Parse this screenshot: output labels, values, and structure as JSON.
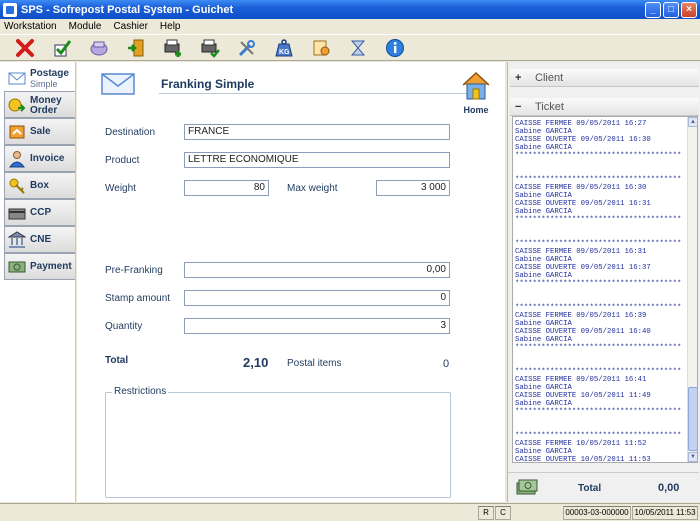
{
  "window": {
    "title": "SPS - Sofrepost Postal System - Guichet"
  },
  "menu": [
    {
      "label": "Workstation"
    },
    {
      "label": "Module"
    },
    {
      "label": "Cashier"
    },
    {
      "label": "Help"
    }
  ],
  "toolbar": {
    "icons": [
      "close-x-icon",
      "check-icon",
      "cart-icon",
      "exit-door-icon",
      "printer-add-icon",
      "printer-check-icon",
      "tools-icon",
      "weight-kg-icon",
      "money-exchange-icon",
      "hourglass-icon",
      "info-icon"
    ]
  },
  "nav": {
    "items": [
      {
        "label": "Postage",
        "sub": "Simple",
        "icon": "envelope-icon"
      },
      {
        "label": "Money",
        "sub": "Order",
        "icon": "money-order-icon"
      },
      {
        "label": "Sale",
        "sub": "",
        "icon": "sale-icon"
      },
      {
        "label": "Invoice",
        "sub": "",
        "icon": "person-icon"
      },
      {
        "label": "Box",
        "sub": "",
        "icon": "key-icon"
      },
      {
        "label": "CCP",
        "sub": "",
        "icon": "card-icon"
      },
      {
        "label": "CNE",
        "sub": "",
        "icon": "bank-icon"
      },
      {
        "label": "Payment",
        "sub": "",
        "icon": "banknote-icon"
      }
    ]
  },
  "form": {
    "title": "Franking Simple",
    "home_label": "Home",
    "destination_label": "Destination",
    "destination_value": "FRANCE",
    "product_label": "Product",
    "product_value": "LETTRE ECONOMIQUE",
    "weight_label": "Weight",
    "weight_value": "80",
    "max_weight_label": "Max weight",
    "max_weight_value": "3 000",
    "prefranking_label": "Pre-Franking",
    "prefranking_value": "0,00",
    "stamp_amount_label": "Stamp amount",
    "stamp_amount_value": "0",
    "quantity_label": "Quantity",
    "quantity_value": "3",
    "total_label": "Total",
    "total_value": "2,10",
    "postal_items_label": "Postal items",
    "postal_items_value": "0",
    "restrictions_label": "Restrictions"
  },
  "right_panel": {
    "client_toggle": "+",
    "client_label": "Client",
    "ticket_toggle": "−",
    "ticket_label": "Ticket",
    "ticket_text": "CAISSE FERMEE 09/05/2011 16:27\nSabine GARCIA\nCAISSE OUVERTE 09/05/2011 16:30\nSabine GARCIA\n**************************************\n\n\n**************************************\nCAISSE FERMEE 09/05/2011 16:30\nSabine GARCIA\nCAISSE OUVERTE 09/05/2011 16:31\nSabine GARCIA\n**************************************\n\n\n**************************************\nCAISSE FERMEE 09/05/2011 16:31\nSabine GARCIA\nCAISSE OUVERTE 09/05/2011 16:37\nSabine GARCIA\n**************************************\n\n\n**************************************\nCAISSE FERMEE 09/05/2011 16:39\nSabine GARCIA\nCAISSE OUVERTE 09/05/2011 16:40\nSabine GARCIA\n**************************************\n\n\n**************************************\nCAISSE FERMEE 09/05/2011 16:41\nSabine GARCIA\nCAISSE OUVERTE 10/05/2011 11:49\nSabine GARCIA\n**************************************\n\n\n**************************************\nCAISSE FERMEE 10/05/2011 11:52\nSabine GARCIA\nCAISSE OUVERTE 10/05/2011 11:53\nSabine GARCIA\n**************************************",
    "total_label": "Total",
    "total_value": "0,00"
  },
  "statusbar": {
    "r": "R",
    "c": "C",
    "session": "00003-03-000000",
    "datetime": "10/05/2011 11:53"
  },
  "colors": {
    "titlebar": "#1a5fd8",
    "label_text": "#1f3a5f",
    "ticket_text": "#1f2d9c"
  }
}
